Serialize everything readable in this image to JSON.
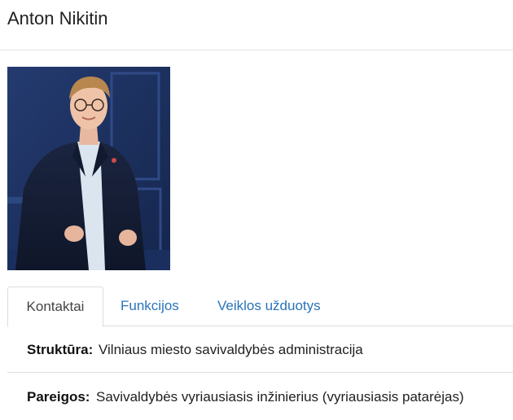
{
  "profile": {
    "name": "Anton Nikitin",
    "photo": "person-photo"
  },
  "tabs": [
    {
      "label": "Kontaktai",
      "active": true
    },
    {
      "label": "Funkcijos",
      "active": false
    },
    {
      "label": "Veiklos užduotys",
      "active": false
    }
  ],
  "details": [
    {
      "label": "Struktūra:",
      "value": "Vilniaus miesto savivaldybės administracija"
    },
    {
      "label": "Pareigos:",
      "value": "Savivaldybės vyriausiasis inžinierius (vyriausiasis patarėjas)"
    }
  ],
  "colors": {
    "link": "#2a73b8",
    "photo_background": "#1c2f5c"
  }
}
